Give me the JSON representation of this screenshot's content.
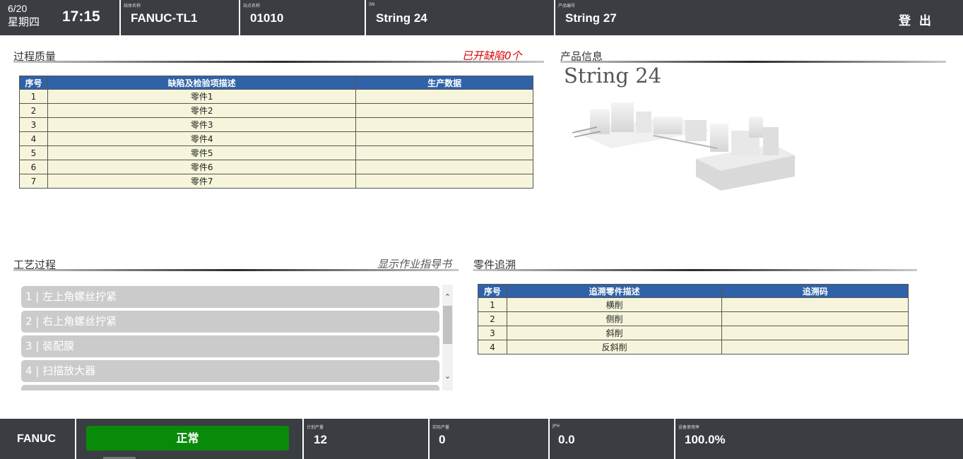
{
  "header": {
    "date": "6/20",
    "weekday": "星期四",
    "time": "17:15",
    "line_label": "线体名称",
    "line_value": "FANUC-TL1",
    "station_label": "站点名称",
    "station_value": "01010",
    "sn_label": "SN",
    "sn_value": "String 24",
    "product_label": "产品编号",
    "product_value": "String 27",
    "logout": "登 出"
  },
  "quality": {
    "title": "过程质量",
    "defects_link": "已开缺陷0个",
    "columns": [
      "序号",
      "缺陷及检验项描述",
      "生产数据"
    ],
    "rows": [
      {
        "no": "1",
        "desc": "零件1",
        "data": ""
      },
      {
        "no": "2",
        "desc": "零件2",
        "data": ""
      },
      {
        "no": "3",
        "desc": "零件3",
        "data": ""
      },
      {
        "no": "4",
        "desc": "零件4",
        "data": ""
      },
      {
        "no": "5",
        "desc": "零件5",
        "data": ""
      },
      {
        "no": "6",
        "desc": "零件6",
        "data": ""
      },
      {
        "no": "7",
        "desc": "零件7",
        "data": ""
      }
    ]
  },
  "product": {
    "title": "产品信息",
    "name": "String 24"
  },
  "process": {
    "title": "工艺过程",
    "guide_link": "显示作业指导书",
    "steps": [
      "1 | 左上角螺丝拧紧",
      "2 | 右上角螺丝拧紧",
      "3 | 装配膜",
      "4 | 扫描放大器"
    ]
  },
  "trace": {
    "title": "零件追溯",
    "columns": [
      "序号",
      "追溯零件描述",
      "追溯码"
    ],
    "rows": [
      {
        "no": "1",
        "desc": "横削",
        "code": ""
      },
      {
        "no": "2",
        "desc": "侧削",
        "code": ""
      },
      {
        "no": "3",
        "desc": "斜削",
        "code": ""
      },
      {
        "no": "4",
        "desc": "反斜削",
        "code": ""
      }
    ]
  },
  "footer": {
    "brand": "FANUC",
    "status": "正常",
    "plan_label": "计划产量",
    "plan_value": "12",
    "actual_label": "实际产量",
    "actual_value": "0",
    "jph_label": "JPH",
    "jph_value": "0.0",
    "util_label": "设备使用率",
    "util_value": "100.0%"
  },
  "colors": {
    "bar_bg": "#3a3d42",
    "table_header": "#2f62a8",
    "table_cell": "#f6f5db",
    "status_ok": "#0a8a0a",
    "defect_link": "#d40000"
  }
}
